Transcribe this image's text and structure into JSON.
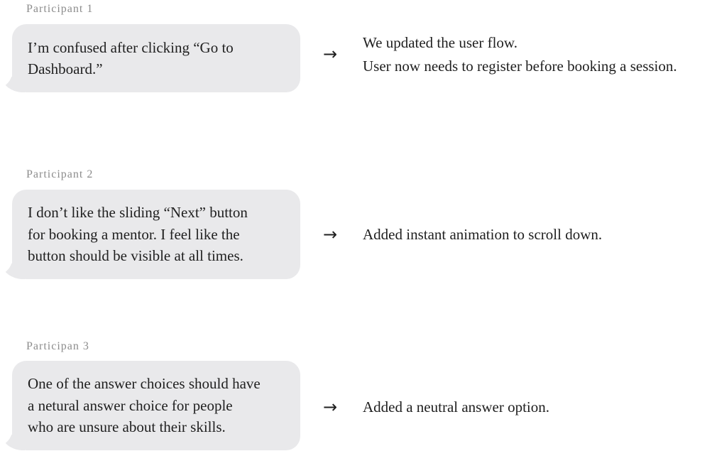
{
  "feedback": [
    {
      "participant": "Participant 1",
      "comment_lines": [
        "I’m confused after clicking “Go to",
        "Dashboard.”"
      ],
      "response_lines": [
        "We updated the user flow.",
        "User now needs to register before booking a session."
      ]
    },
    {
      "participant": "Participant 2",
      "comment_lines": [
        "I don’t like the sliding “Next” button",
        "for booking a mentor. I feel like the",
        "button should be visible at all times."
      ],
      "response_lines": [
        "Added instant animation to scroll down."
      ]
    },
    {
      "participant": "Participan 3",
      "comment_lines": [
        "One of the answer choices should have",
        "a netural answer choice for people",
        "who are unsure about their skills."
      ],
      "response_lines": [
        "Added a neutral answer option."
      ]
    }
  ],
  "icons": {
    "arrow": "arrow-right-icon"
  },
  "colors": {
    "bubble": "#e9e9eb",
    "label": "#8c8c8c",
    "text": "#1f1f1f"
  }
}
